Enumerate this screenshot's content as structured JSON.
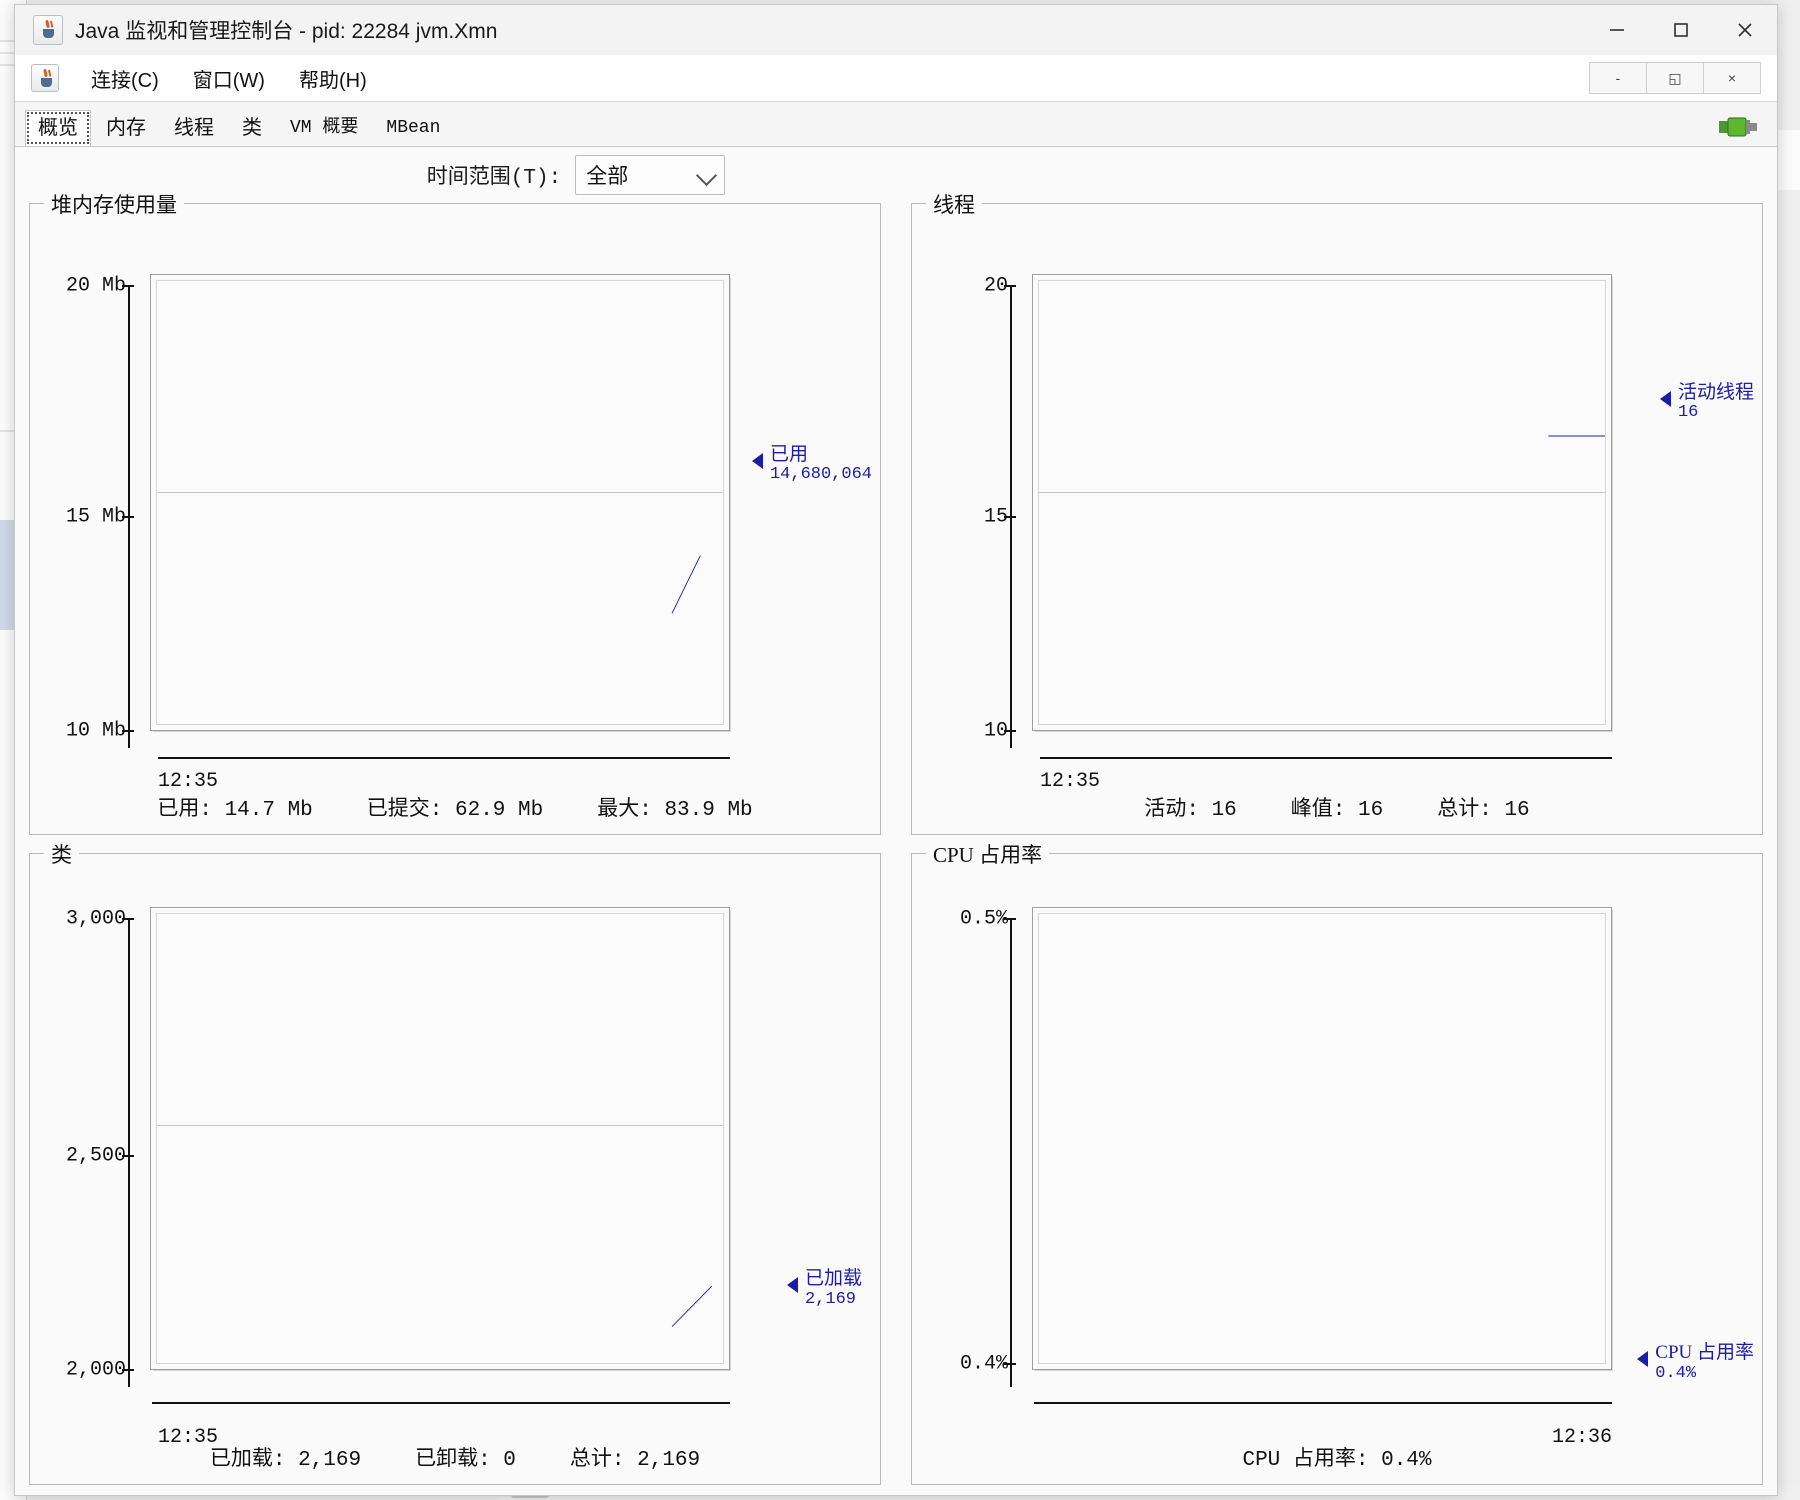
{
  "window": {
    "title": "Java 监视和管理控制台 - pid: 22284 jvm.Xmn",
    "minimize_label": "─",
    "maximize_label": "□",
    "close_label": "✕"
  },
  "menubar": {
    "items": [
      {
        "label": "连接(C)"
      },
      {
        "label": "窗口(W)"
      },
      {
        "label": "帮助(H)"
      }
    ],
    "inner_buttons": [
      {
        "label": "-",
        "name": "inner-minimize-button"
      },
      {
        "label": "◱",
        "name": "inner-restore-button"
      },
      {
        "label": "×",
        "name": "inner-close-button"
      }
    ]
  },
  "tabs": [
    {
      "label": "概览",
      "active": true,
      "mono": false
    },
    {
      "label": "内存",
      "active": false,
      "mono": false
    },
    {
      "label": "线程",
      "active": false,
      "mono": false
    },
    {
      "label": "类",
      "active": false,
      "mono": false
    },
    {
      "label": "VM 概要",
      "active": false,
      "mono": true
    },
    {
      "label": "MBean",
      "active": false,
      "mono": true
    }
  ],
  "toolbar": {
    "time_range_label": "时间范围(T):",
    "time_range_value": "全部",
    "time_range_options": [
      "全部"
    ]
  },
  "colors": {
    "series": "#1c1ca8",
    "axis": "#111111",
    "gridline": "#c6c6c6",
    "panel_bg": "#fafafa"
  },
  "panels": {
    "heap": {
      "title": "堆内存使用量",
      "y_ticks": [
        "20 Mb",
        "15 Mb",
        "10 Mb"
      ],
      "x_labels": [
        "12:35"
      ],
      "annotation": {
        "name": "已用",
        "value": "14,680,064"
      },
      "stats": [
        {
          "label": "已用:",
          "value": "14.7  Mb"
        },
        {
          "label": "已提交:",
          "value": "62.9  Mb"
        },
        {
          "label": "最大:",
          "value": "83.9  Mb"
        }
      ]
    },
    "threads": {
      "title": "线程",
      "y_ticks": [
        "20",
        "15",
        "10"
      ],
      "x_labels": [
        "12:35"
      ],
      "annotation": {
        "name": "活动线程",
        "value": "16"
      },
      "stats": [
        {
          "label": "活动:",
          "value": "16"
        },
        {
          "label": "峰值:",
          "value": "16"
        },
        {
          "label": "总计:",
          "value": "16"
        }
      ]
    },
    "classes": {
      "title": "类",
      "y_ticks": [
        "3,000",
        "2,500",
        "2,000"
      ],
      "x_labels": [
        "12:35"
      ],
      "annotation": {
        "name": "已加载",
        "value": "2,169"
      },
      "stats": [
        {
          "label": "已加载:",
          "value": "2,169"
        },
        {
          "label": "已卸载:",
          "value": "0"
        },
        {
          "label": "总计:",
          "value": "2,169"
        }
      ]
    },
    "cpu": {
      "title": "CPU 占用率",
      "y_ticks": [
        "0.5%",
        "0.4%"
      ],
      "x_labels": [
        "12:36"
      ],
      "annotation": {
        "name": "CPU 占用率",
        "value": "0.4%"
      },
      "stats": [
        {
          "label": "CPU 占用率:",
          "value": "0.4%"
        }
      ]
    }
  },
  "chart_data": [
    {
      "type": "line",
      "title": "堆内存使用量",
      "ylabel": "Mb",
      "ylim": [
        10,
        20
      ],
      "yticks": [
        20,
        15,
        10
      ],
      "ytick_labels": [
        "20 Mb",
        "15 Mb",
        "10 Mb"
      ],
      "x": [
        "12:35"
      ],
      "series": [
        {
          "name": "已用",
          "values": [
            14.68
          ],
          "last_label": "14,680,064",
          "color": "#1c1ca8"
        }
      ],
      "grid": true,
      "legend": "right-annotation"
    },
    {
      "type": "line",
      "title": "线程",
      "ylabel": "",
      "ylim": [
        10,
        20
      ],
      "yticks": [
        20,
        15,
        10
      ],
      "ytick_labels": [
        "20",
        "15",
        "10"
      ],
      "x": [
        "12:35"
      ],
      "series": [
        {
          "name": "活动线程",
          "values": [
            16
          ],
          "last_label": "16",
          "color": "#1c1ca8"
        }
      ],
      "grid": true,
      "legend": "right-annotation"
    },
    {
      "type": "line",
      "title": "类",
      "ylabel": "",
      "ylim": [
        2000,
        3000
      ],
      "yticks": [
        3000,
        2500,
        2000
      ],
      "ytick_labels": [
        "3,000",
        "2,500",
        "2,000"
      ],
      "x": [
        "12:35"
      ],
      "series": [
        {
          "name": "已加载",
          "values": [
            2169
          ],
          "last_label": "2,169",
          "color": "#1c1ca8"
        }
      ],
      "grid": true,
      "legend": "right-annotation"
    },
    {
      "type": "line",
      "title": "CPU 占用率",
      "ylabel": "%",
      "ylim": [
        0.4,
        0.5
      ],
      "yticks": [
        0.5,
        0.4
      ],
      "ytick_labels": [
        "0.5%",
        "0.4%"
      ],
      "x": [
        "12:36"
      ],
      "series": [
        {
          "name": "CPU 占用率",
          "values": [
            0.4
          ],
          "last_label": "0.4%",
          "color": "#1c1ca8"
        }
      ],
      "grid": false,
      "legend": "right-annotation"
    }
  ]
}
